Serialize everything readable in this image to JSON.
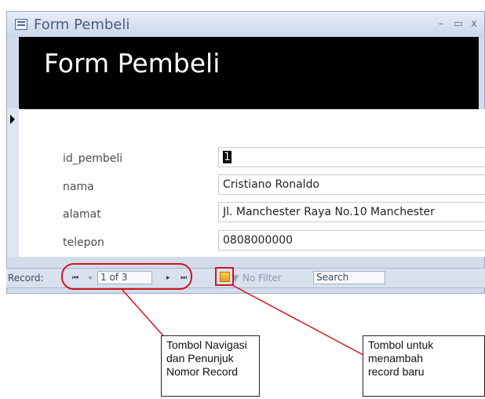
{
  "window": {
    "title": "Form Pembeli",
    "minimize_symbol": "–",
    "restore_symbol": "▭",
    "close_symbol": "x"
  },
  "form": {
    "header": "Form Pembeli",
    "fields": [
      {
        "label": "id_pembeli",
        "value": "1"
      },
      {
        "label": "nama",
        "value": "Cristiano Ronaldo"
      },
      {
        "label": "alamat",
        "value": "Jl. Manchester Raya No.10 Manchester"
      },
      {
        "label": "telepon",
        "value": "0808000000"
      }
    ]
  },
  "navigation": {
    "record_label": "Record:",
    "first_symbol": "⏮",
    "prev_symbol": "◂",
    "record_position": "1 of 3",
    "next_symbol": "▸",
    "last_symbol": "⏭",
    "no_filter": "No Filter",
    "search_placeholder": "Search"
  },
  "annotations": {
    "navigation_note": "Tombol Navigasi\ndan Penunjuk\nNomor Record",
    "new_record_note": "Tombol untuk\nmenambah\nrecord baru",
    "highlight_color": "#d1161b"
  }
}
